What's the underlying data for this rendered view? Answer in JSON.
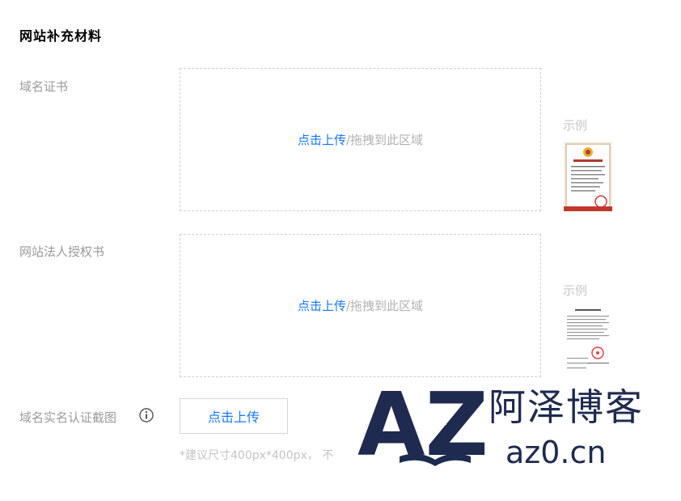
{
  "section": {
    "title": "网站补充材料"
  },
  "fields": [
    {
      "label": "域名证书",
      "upload_link": "点击上传",
      "upload_rest": "/拖拽到此区域",
      "example_label": "示例"
    },
    {
      "label": "网站法人授权书",
      "upload_link": "点击上传",
      "upload_rest": "/拖拽到此区域",
      "example_label": "示例"
    }
  ],
  "realname": {
    "label": "域名实名认证截图",
    "button_label": "点击上传",
    "hint": "*建议尺寸400px*400px，   不"
  },
  "watermark": {
    "logo_text": "AZ",
    "cn_name": "阿泽博客",
    "url": "az0.cn"
  },
  "colors": {
    "link": "#1677ff",
    "label": "#9a9a9a",
    "border": "#cfcfcf",
    "watermark": "#1e2a4f"
  }
}
